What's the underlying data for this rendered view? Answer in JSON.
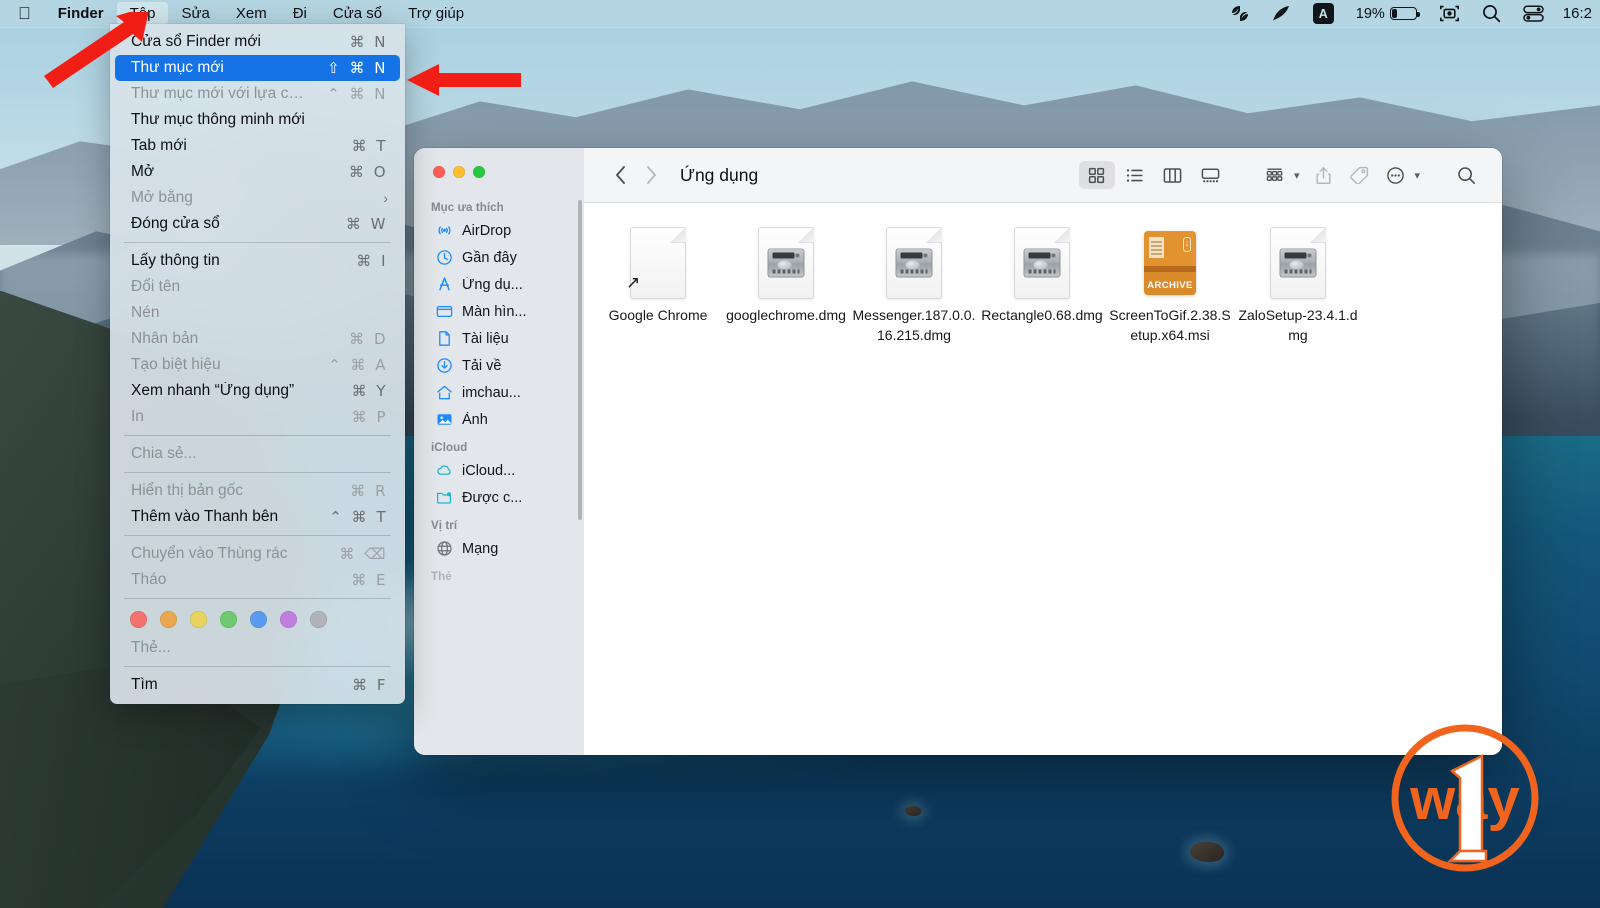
{
  "menubar": {
    "apple_icon": "apple-logo-icon",
    "items": [
      {
        "label": "Finder",
        "bold": true,
        "active": false
      },
      {
        "label": "Tệp",
        "bold": false,
        "active": true
      },
      {
        "label": "Sửa",
        "bold": false,
        "active": false
      },
      {
        "label": "Xem",
        "bold": false,
        "active": false
      },
      {
        "label": "Đi",
        "bold": false,
        "active": false
      },
      {
        "label": "Cửa sổ",
        "bold": false,
        "active": false
      },
      {
        "label": "Trợ giúp",
        "bold": false,
        "active": false
      }
    ],
    "status": {
      "leaf_icon": "leaf-icon",
      "feather_icon": "feather-icon",
      "input_badge": "A",
      "battery_percent": "19%",
      "battery_level": 19,
      "screenshot_icon": "screenshot-icon",
      "search_icon": "search-icon",
      "control_center_icon": "control-center-icon",
      "clock": "16:2"
    }
  },
  "file_menu": {
    "title": "Tệp",
    "groups": [
      {
        "items": [
          {
            "label": "Cửa sổ Finder mới",
            "shortcut": "⌘ N",
            "disabled": false,
            "selected": false
          },
          {
            "label": "Thư mục mới",
            "shortcut": "⇧ ⌘ N",
            "disabled": false,
            "selected": true
          },
          {
            "label": "Thư mục mới với lựa chọn",
            "shortcut": "⌃ ⌘ N",
            "disabled": true,
            "selected": false
          },
          {
            "label": "Thư mục thông minh mới",
            "shortcut": "",
            "disabled": false,
            "selected": false
          },
          {
            "label": "Tab mới",
            "shortcut": "⌘ T",
            "disabled": false,
            "selected": false
          },
          {
            "label": "Mở",
            "shortcut": "⌘ O",
            "disabled": false,
            "selected": false
          },
          {
            "label": "Mở bằng",
            "shortcut": "",
            "submenu": true,
            "disabled": true,
            "selected": false
          },
          {
            "label": "Đóng cửa sổ",
            "shortcut": "⌘ W",
            "disabled": false,
            "selected": false
          }
        ]
      },
      {
        "items": [
          {
            "label": "Lấy thông tin",
            "shortcut": "⌘ I",
            "disabled": false,
            "selected": false
          },
          {
            "label": "Đổi tên",
            "shortcut": "",
            "disabled": true,
            "selected": false
          },
          {
            "label": "Nén",
            "shortcut": "",
            "disabled": true,
            "selected": false
          },
          {
            "label": "Nhân bản",
            "shortcut": "⌘ D",
            "disabled": true,
            "selected": false
          },
          {
            "label": "Tạo biệt hiệu",
            "shortcut": "⌃ ⌘ A",
            "disabled": true,
            "selected": false
          },
          {
            "label": "Xem nhanh “Ứng dụng”",
            "shortcut": "⌘ Y",
            "disabled": false,
            "selected": false
          },
          {
            "label": "In",
            "shortcut": "⌘ P",
            "disabled": true,
            "selected": false
          }
        ]
      },
      {
        "items": [
          {
            "label": "Chia sẻ...",
            "shortcut": "",
            "disabled": true,
            "selected": false
          }
        ]
      },
      {
        "items": [
          {
            "label": "Hiển thị bản gốc",
            "shortcut": "⌘ R",
            "disabled": true,
            "selected": false
          },
          {
            "label": "Thêm vào Thanh bên",
            "shortcut": "⌃ ⌘ T",
            "disabled": false,
            "selected": false
          }
        ]
      },
      {
        "items": [
          {
            "label": "Chuyển vào Thùng rác",
            "shortcut": "⌘ ⌫",
            "disabled": true,
            "selected": false
          },
          {
            "label": "Tháo",
            "shortcut": "⌘ E",
            "disabled": true,
            "selected": false
          }
        ]
      },
      {
        "tags": [
          "#f2726e",
          "#e9a84f",
          "#e8d35c",
          "#6fc96f",
          "#5b9bee",
          "#c07fdd",
          "#b0b4b8"
        ],
        "items": [
          {
            "label": "Thẻ...",
            "shortcut": "",
            "disabled": true,
            "selected": false
          }
        ]
      },
      {
        "items": [
          {
            "label": "Tìm",
            "shortcut": "⌘ F",
            "disabled": false,
            "selected": false
          }
        ]
      }
    ]
  },
  "finder": {
    "title": "Ứng dụng",
    "traffic_lights": [
      "close",
      "minimize",
      "zoom"
    ],
    "nav": {
      "back": "‹",
      "forward": "›"
    },
    "toolbar_buttons": [
      {
        "name": "icon-view",
        "active": true
      },
      {
        "name": "list-view",
        "active": false
      },
      {
        "name": "column-view",
        "active": false
      },
      {
        "name": "gallery-view",
        "active": false
      },
      {
        "name": "group-by",
        "active": false
      },
      {
        "name": "share",
        "active": false
      },
      {
        "name": "tags",
        "active": false
      },
      {
        "name": "more-actions",
        "active": false
      },
      {
        "name": "search",
        "active": false
      }
    ],
    "sidebar": {
      "sections": [
        {
          "header": "Mục ưa thích",
          "items": [
            {
              "label": "AirDrop",
              "icon": "airdrop-icon"
            },
            {
              "label": "Gần đây",
              "icon": "clock-icon"
            },
            {
              "label": "Ứng dụ...",
              "icon": "applications-icon"
            },
            {
              "label": "Màn hìn...",
              "icon": "desktop-icon"
            },
            {
              "label": "Tài liệu",
              "icon": "document-icon"
            },
            {
              "label": "Tải về",
              "icon": "downloads-icon"
            },
            {
              "label": "imchau...",
              "icon": "home-icon"
            },
            {
              "label": "Ảnh",
              "icon": "photos-icon"
            }
          ]
        },
        {
          "header": "iCloud",
          "items": [
            {
              "label": "iCloud...",
              "icon": "cloud-icon"
            },
            {
              "label": "Được c...",
              "icon": "shared-folder-icon"
            }
          ]
        },
        {
          "header": "Vị trí",
          "items": [
            {
              "label": "Mạng",
              "icon": "network-globe-icon"
            }
          ]
        },
        {
          "header": "Thẻ",
          "items": []
        }
      ]
    },
    "files": [
      {
        "name": "Google Chrome",
        "type": "alias"
      },
      {
        "name": "googlechrome.dmg",
        "type": "dmg"
      },
      {
        "name": "Messenger.187.0.0.16.215.dmg",
        "type": "dmg"
      },
      {
        "name": "Rectangle0.68.dmg",
        "type": "dmg"
      },
      {
        "name": "ScreenToGif.2.38.Setup.x64.msi",
        "type": "msi",
        "badge": "ARCHIVE"
      },
      {
        "name": "ZaloSetup-23.4.1.dmg",
        "type": "dmg"
      }
    ]
  },
  "annotations": {
    "arrow_color": "#f01e14",
    "arrows": [
      {
        "name": "arrow-to-file-menu",
        "target": "Tệp"
      },
      {
        "name": "arrow-to-new-folder",
        "target": "Thư mục mới"
      }
    ]
  },
  "watermark": {
    "text": "way",
    "number": "1",
    "color": "#f0641e"
  }
}
